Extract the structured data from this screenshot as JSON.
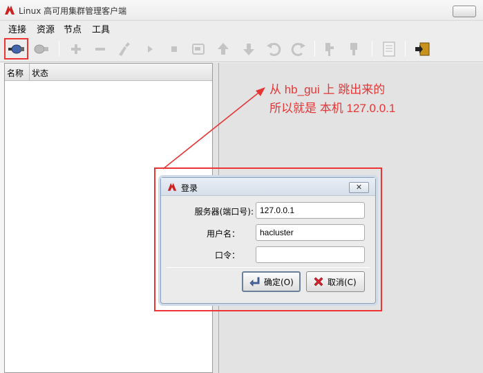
{
  "window": {
    "title": "Linux 高可用集群管理客户端"
  },
  "menu": {
    "items": [
      "连接",
      "资源",
      "节点",
      "工具"
    ]
  },
  "toolbar": {
    "icons": [
      "connect-icon",
      "disconnect-icon",
      "add-icon",
      "remove-icon",
      "cleanup-icon",
      "start-icon",
      "stop-icon",
      "migrate-icon",
      "move-up-icon",
      "move-down-icon",
      "undo-icon",
      "redo-icon",
      "standby-icon",
      "active-icon",
      "log-icon",
      "exit-icon"
    ]
  },
  "tree": {
    "columns": [
      "名称",
      "状态"
    ]
  },
  "annotation": {
    "line1": "从 hb_gui 上 跳出来的",
    "line2": "所以就是 本机 127.0.0.1",
    "color": "#e53535"
  },
  "dialog": {
    "title": "登录",
    "close_label": "✕",
    "server_label": "服务器(端口号):",
    "server_value": "127.0.0.1",
    "username_label": "用户名：",
    "username_value": "hacluster",
    "password_label": "口令：",
    "password_value": "",
    "ok_label": "确定(O)",
    "cancel_label": "取消(C)"
  }
}
